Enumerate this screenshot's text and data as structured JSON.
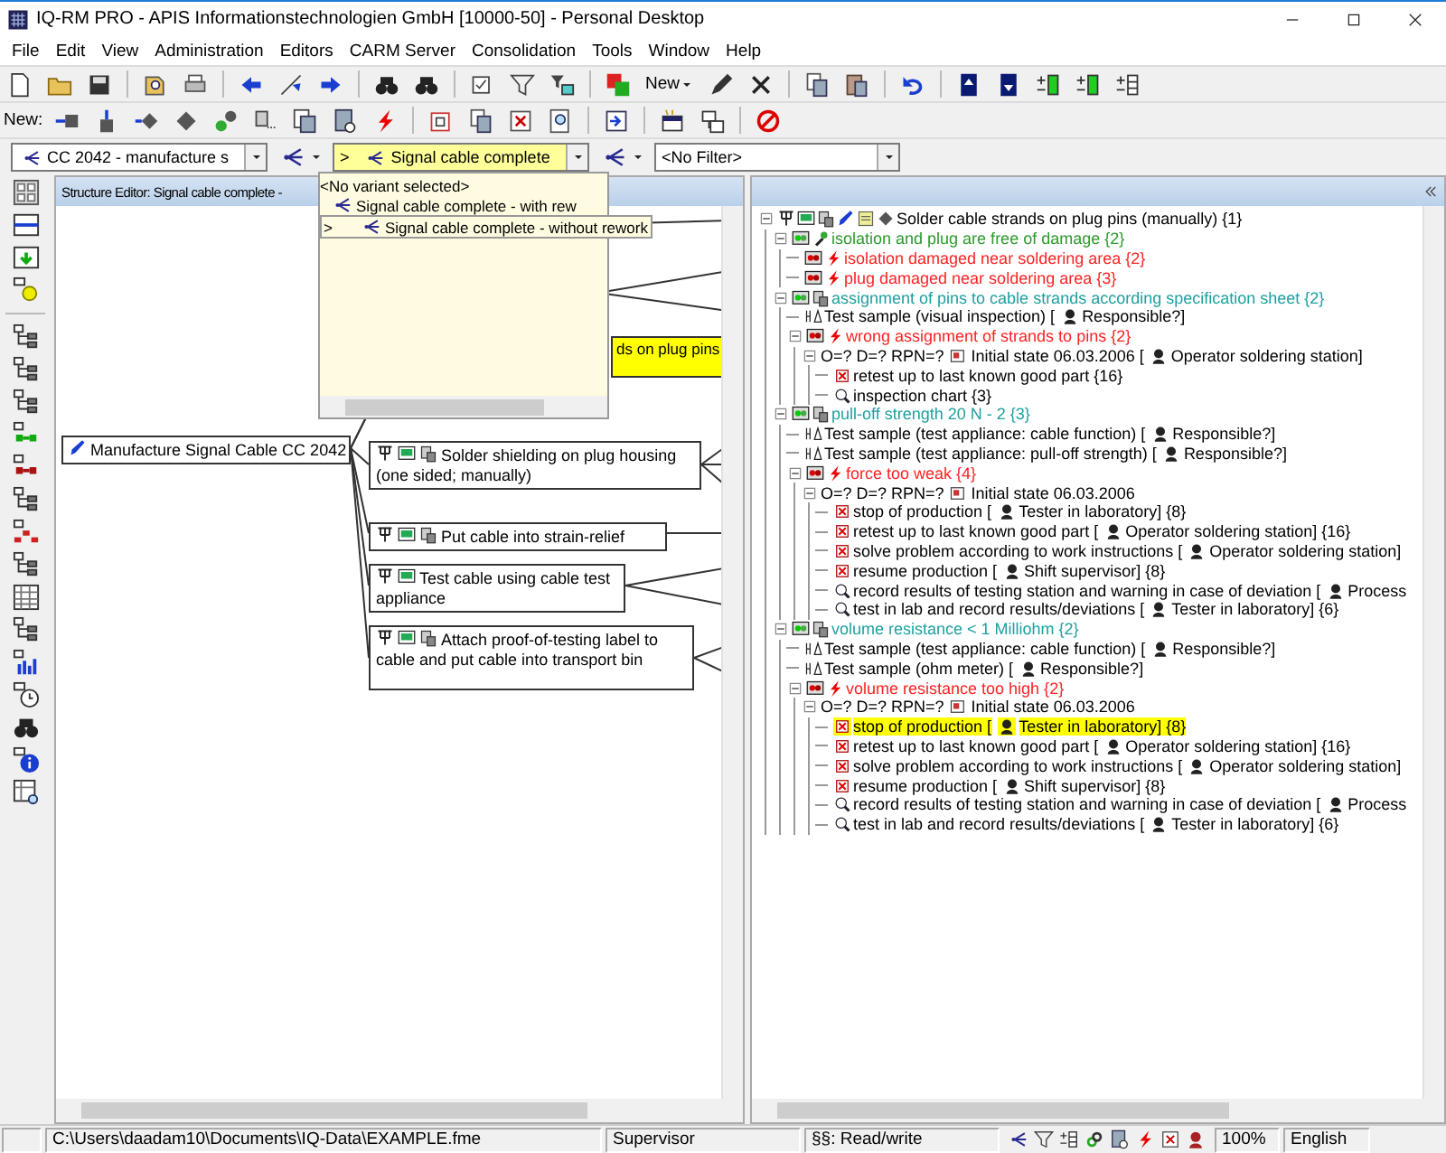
{
  "window": {
    "title": "IQ-RM PRO - APIS Informationstechnologien GmbH [10000-50] - Personal Desktop"
  },
  "menu": [
    "File",
    "Edit",
    "View",
    "Administration",
    "Editors",
    "CARM Server",
    "Consolidation",
    "Tools",
    "Window",
    "Help"
  ],
  "toolbar": {
    "new_button": "New"
  },
  "new_toolbar": {
    "label": "New:"
  },
  "selectors": {
    "project": "CC 2042 - manufacture s",
    "variant": {
      "marker": ">",
      "text": "Signal cable complete"
    },
    "filter": "<No Filter>"
  },
  "variant_popup": {
    "items": [
      {
        "kind": "plain",
        "text": "<No variant selected>",
        "selected": false
      },
      {
        "kind": "variant",
        "text": "Signal cable complete - with rew",
        "selected": false
      },
      {
        "kind": "variant",
        "marker": ">",
        "text": "Signal cable complete - without rework",
        "selected": true
      }
    ]
  },
  "structure_editor": {
    "title": "Structure Editor: Signal cable complete -",
    "nodes": [
      {
        "kind": "partial",
        "text": "ds on plug pins",
        "selected": true
      },
      {
        "kind": "root",
        "text": "Manufacture Signal Cable CC 2042",
        "selected": false
      },
      {
        "kind": "step",
        "text": "Solder shielding on plug housing (one sided; manually)",
        "selected": false
      },
      {
        "kind": "step",
        "text": "Put cable into strain-relief",
        "selected": false
      },
      {
        "kind": "test_step",
        "text": "Test cable using cable test appliance",
        "selected": false
      },
      {
        "kind": "step",
        "text": "Attach proof-of-testing label to cable and put cable into transport bin",
        "selected": false
      }
    ]
  },
  "tree": {
    "root": {
      "kind": "function",
      "text": "Solder cable strands on plug pins (manually) {1}",
      "selected": false,
      "expanded": true,
      "children": [
        {
          "kind": "requirement",
          "text": "isolation and plug are free of damage {2}",
          "selected": false,
          "expanded": true,
          "children": [
            {
              "kind": "failure",
              "text": "isolation damaged near soldering area {2}",
              "selected": false
            },
            {
              "kind": "failure",
              "text": "plug damaged near soldering area {3}",
              "selected": false
            }
          ]
        },
        {
          "kind": "characteristic",
          "text": "assignment of pins to cable strands according specification sheet {2}",
          "selected": false,
          "expanded": true,
          "children": [
            {
              "kind": "test",
              "text": "Test sample (visual inspection) [",
              "person": "Responsible?]",
              "selected": false
            },
            {
              "kind": "failure",
              "text": "wrong assignment of strands to pins {2}",
              "selected": false,
              "expanded": true,
              "children": [
                {
                  "kind": "state",
                  "text": "O=? D=? RPN=?",
                  "state": "Initial state 06.03.2006 [",
                  "person": "Operator soldering station]",
                  "selected": false,
                  "expanded": true,
                  "children": [
                    {
                      "kind": "action",
                      "text": "retest up to last known good part {16}",
                      "selected": false
                    },
                    {
                      "kind": "inspection",
                      "text": "inspection chart {3}",
                      "selected": false
                    }
                  ]
                }
              ]
            }
          ]
        },
        {
          "kind": "characteristic",
          "text": "pull-off strength 20 N - 2 {3}",
          "selected": false,
          "expanded": true,
          "children": [
            {
              "kind": "test",
              "text": "Test sample (test appliance: cable function) [",
              "person": "Responsible?]",
              "selected": false
            },
            {
              "kind": "test",
              "text": "Test sample (test appliance: pull-off strength) [",
              "person": "Responsible?]",
              "selected": false
            },
            {
              "kind": "failure",
              "text": "force too weak {4}",
              "selected": false,
              "expanded": true,
              "children": [
                {
                  "kind": "state",
                  "text": "O=? D=? RPN=?",
                  "state": "Initial state 06.03.2006",
                  "selected": false,
                  "expanded": true,
                  "children": [
                    {
                      "kind": "action",
                      "text": "stop of production [",
                      "person": "Tester in laboratory] {8}",
                      "selected": false
                    },
                    {
                      "kind": "action",
                      "text": "retest up to last known good part [",
                      "person": "Operator soldering station] {16}",
                      "selected": false
                    },
                    {
                      "kind": "action",
                      "text": "solve problem according to work instructions [",
                      "person": "Operator soldering station]",
                      "selected": false
                    },
                    {
                      "kind": "action",
                      "text": "resume production [",
                      "person": "Shift supervisor] {8}",
                      "selected": false
                    },
                    {
                      "kind": "inspection",
                      "text": "record results of testing station and warning in case of deviation [",
                      "person": "Process",
                      "selected": false
                    },
                    {
                      "kind": "inspection",
                      "text": "test in lab and record results/deviations [",
                      "person": "Tester in laboratory] {6}",
                      "selected": false
                    }
                  ]
                }
              ]
            }
          ]
        },
        {
          "kind": "characteristic",
          "text": "volume resistance < 1 Milliohm {2}",
          "selected": false,
          "expanded": true,
          "children": [
            {
              "kind": "test",
              "text": "Test sample (test appliance: cable function) [",
              "person": "Responsible?]",
              "selected": false
            },
            {
              "kind": "test",
              "text": "Test sample (ohm meter) [",
              "person": "Responsible?]",
              "selected": false
            },
            {
              "kind": "failure",
              "text": "volume resistance too high {2}",
              "selected": false,
              "expanded": true,
              "children": [
                {
                  "kind": "state",
                  "text": "O=? D=? RPN=?",
                  "state": "Initial state 06.03.2006",
                  "selected": false,
                  "expanded": true,
                  "children": [
                    {
                      "kind": "action",
                      "text": "stop of production [",
                      "person": "Tester in laboratory] {8}",
                      "selected": true
                    },
                    {
                      "kind": "action",
                      "text": "retest up to last known good part [",
                      "person": "Operator soldering station] {16}",
                      "selected": false
                    },
                    {
                      "kind": "action",
                      "text": "solve problem according to work instructions [",
                      "person": "Operator soldering station]",
                      "selected": false
                    },
                    {
                      "kind": "action",
                      "text": "resume production [",
                      "person": "Shift supervisor] {8}",
                      "selected": false
                    },
                    {
                      "kind": "inspection",
                      "text": "record results of testing station and warning in case of deviation [",
                      "person": "Process",
                      "selected": false
                    },
                    {
                      "kind": "inspection",
                      "text": "test in lab and record results/deviations [",
                      "person": "Tester in laboratory] {6}",
                      "selected": false
                    }
                  ]
                }
              ]
            }
          ]
        }
      ]
    }
  },
  "status_bar": {
    "path": "C:\\Users\\daadam10\\Documents\\IQ-Data\\EXAMPLE.fme",
    "user": "Supervisor",
    "access": "§§: Read/write",
    "zoom": "100%",
    "language": "English"
  }
}
